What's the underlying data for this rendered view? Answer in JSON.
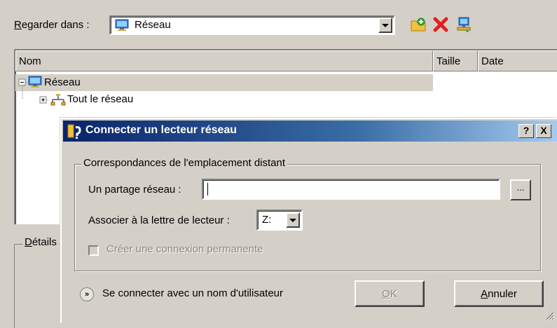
{
  "toolbar": {
    "look_in_label_u": "R",
    "look_in_label_rest": "egarder dans :",
    "look_in_value": "Réseau"
  },
  "list": {
    "columns": [
      "Nom",
      "Taille",
      "Date"
    ],
    "items": [
      {
        "label": "Réseau",
        "icon": "network-icon",
        "expanded": true
      },
      {
        "label": "Tout le réseau",
        "icon": "entire-network-icon",
        "expanded": false
      }
    ]
  },
  "details": {
    "label_u": "D",
    "label_rest": "étails"
  },
  "dialog": {
    "title": "Connecter un lecteur réseau",
    "help_button": "?",
    "close_button": "X",
    "group_label": "Correspondances de l'emplacement distant",
    "share_label": "Un partage réseau :",
    "share_value": "",
    "browse_label": "...",
    "drive_label": "Associer à la lettre de lecteur :",
    "drive_value": "Z:",
    "persistent_label": "Créer une connexion permanente",
    "persistent_checked": false,
    "user_label": "Se connecter avec un nom d'utilisateur",
    "ok_u": "O",
    "ok_rest": "K",
    "cancel_u": "A",
    "cancel_rest": "nnuler"
  },
  "colors": {
    "window_bg": "#d4d0c8",
    "title_gradient_start": "#0a246a",
    "title_gradient_end": "#a6caf0",
    "disabled_text": "#8a877f"
  }
}
